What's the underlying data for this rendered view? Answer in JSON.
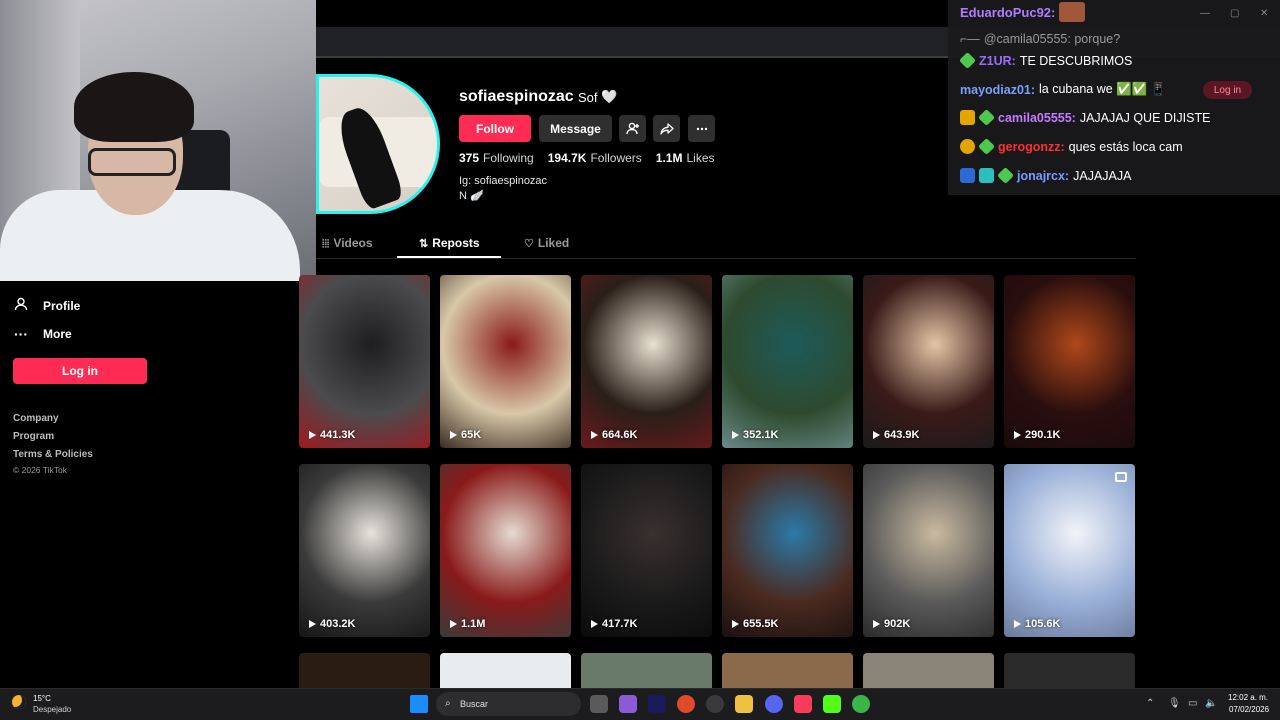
{
  "profile": {
    "username": "sofiaespinozac",
    "nickname": "Sof",
    "nickname_emoji": "🤍",
    "follow_label": "Follow",
    "message_label": "Message",
    "stats": {
      "following_count": "375",
      "following_label": "Following",
      "followers_count": "194.7K",
      "followers_label": "Followers",
      "likes_count": "1.1M",
      "likes_label": "Likes"
    },
    "bio_line1": "Ig: sofiaespinozac",
    "bio_line2": "N 🪽"
  },
  "tabs": [
    {
      "label": "Videos",
      "icon": "grid-icon"
    },
    {
      "label": "Reposts",
      "icon": "repost-icon",
      "active": true
    },
    {
      "label": "Liked",
      "icon": "heart-outline-icon"
    }
  ],
  "sidebar": {
    "items": [
      {
        "label": "Profile",
        "icon": "person-icon"
      },
      {
        "label": "More",
        "icon": "more-icon"
      }
    ],
    "login_label": "Log in",
    "footer": [
      "Company",
      "Program",
      "Terms & Policies"
    ],
    "copyright": "© 2026 TikTok"
  },
  "videos": [
    {
      "views": "441.3K",
      "colors": [
        "#4b4b4d",
        "#1e1e20",
        "#a01820"
      ]
    },
    {
      "views": "65K",
      "colors": [
        "#d8c8a8",
        "#8a1a1a",
        "#3a2a20"
      ]
    },
    {
      "views": "664.6K",
      "colors": [
        "#2a1e18",
        "#e8e0d0",
        "#6a1a1c"
      ]
    },
    {
      "views": "352.1K",
      "colors": [
        "#2e4a2e",
        "#1d5a5a",
        "#6a8a8a"
      ]
    },
    {
      "views": "643.9K",
      "colors": [
        "#3a1a18",
        "#e2c6a6",
        "#1a1a1a"
      ]
    },
    {
      "views": "290.1K",
      "colors": [
        "#2a0e0e",
        "#b0481a",
        "#1a0a0a"
      ]
    },
    {
      "views": "403.2K",
      "colors": [
        "#3a3a3a",
        "#e8e4dc",
        "#151515"
      ]
    },
    {
      "views": "1.1M",
      "colors": [
        "#8a1a1a",
        "#e4dcd0",
        "#3a3a3a"
      ]
    },
    {
      "views": "417.7K",
      "colors": [
        "#1a1a1a",
        "#3a3030",
        "#0a0a0a"
      ]
    },
    {
      "views": "655.5K",
      "colors": [
        "#4a2a20",
        "#2a7aa8",
        "#1a1010"
      ]
    },
    {
      "views": "902K",
      "colors": [
        "#5a5a5a",
        "#cabaa0",
        "#2a2a2a"
      ]
    },
    {
      "views": "105.6K",
      "colors": [
        "#9ab0d8",
        "#f2f4f8",
        "#6a7a9a"
      ]
    }
  ],
  "next_row_colors": [
    "#2a1c12",
    "#e8ecef",
    "#6a7a6a",
    "#8a6a4a",
    "#8a8478",
    "#2a2a2a"
  ],
  "chat": {
    "header_user": "EduardoPuc92:",
    "header_user_color": "#b27cff",
    "reply_to": "@camila05555: porque?",
    "messages": [
      {
        "user": "Z1UR:",
        "color": "#9b6cff",
        "text": "TE DESCUBRIMOS"
      },
      {
        "user": "mayodiaz01:",
        "color": "#7aa0ff",
        "text": "la cubana we ✅✅ 📱"
      },
      {
        "user": "camila05555:",
        "color": "#c57bff",
        "text": "JAJAJAJ QUE DIJISTE"
      },
      {
        "user": "gerogonzz:",
        "color": "#ff3030",
        "text": "ques estás loca cam"
      },
      {
        "user": "jonajrcx:",
        "color": "#7a9bff",
        "text": "JAJAJAJA"
      }
    ],
    "login_label": "Log in"
  },
  "taskbar": {
    "temperature": "15°C",
    "weather": "Despejado",
    "search_placeholder": "Buscar",
    "time": "12:02 a. m.",
    "date": "07/02/2026"
  }
}
